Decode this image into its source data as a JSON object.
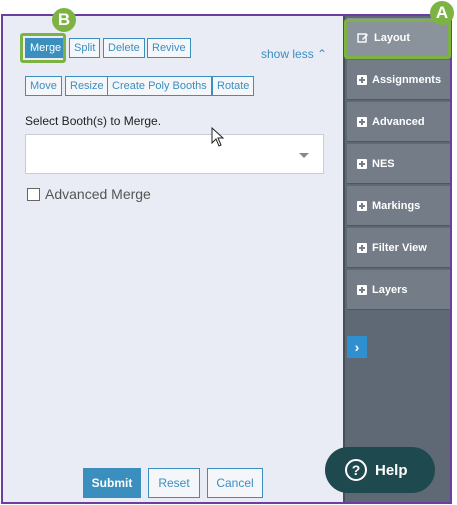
{
  "toolbar": {
    "row1": [
      "Merge",
      "Split",
      "Delete",
      "Revive"
    ],
    "row2": [
      "Move",
      "Resize",
      "Create Poly Booths",
      "Rotate"
    ],
    "show_less": "show less"
  },
  "form": {
    "select_label": "Select Booth(s) to Merge.",
    "select_value": "",
    "advanced_label": "Advanced Merge",
    "advanced_checked": false
  },
  "actions": {
    "submit": "Submit",
    "reset": "Reset",
    "cancel": "Cancel"
  },
  "sidebar": {
    "items": [
      "Layout",
      "Assignments",
      "Advanced",
      "NES",
      "Markings",
      "Filter View",
      "Layers"
    ],
    "active": "Layout"
  },
  "help": {
    "label": "Help",
    "icon": "?"
  },
  "callouts": {
    "a": "A",
    "b": "B"
  },
  "colors": {
    "accent": "#3a8fbf",
    "frame": "#6b3fa0",
    "highlight": "#7cb342",
    "help_bg": "#1e4a4f"
  }
}
